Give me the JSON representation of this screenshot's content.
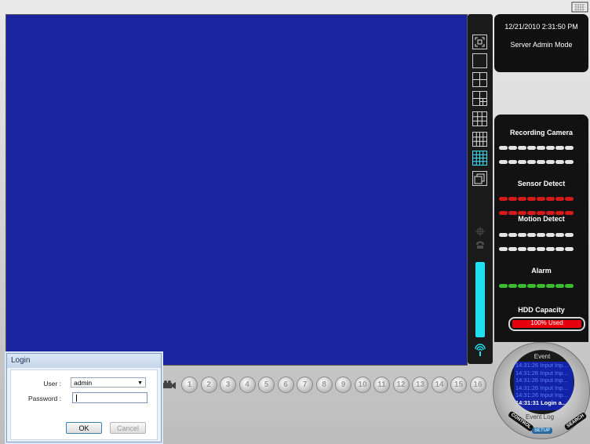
{
  "status_panel": {
    "datetime": "12/21/2010 2:31:50 PM",
    "mode": "Server Admin Mode",
    "recording_camera": "Recording Camera",
    "sensor_detect": "Sensor Detect",
    "motion_detect": "Motion Detect",
    "alarm": "Alarm",
    "hdd_capacity": "HDD Capacity",
    "hdd_used_text": "100% Used",
    "hdd_used_fraction": 1.0,
    "colors": {
      "sensor": "#d41a1a",
      "alarm": "#3bbc2e",
      "recording": "#e4e4e4",
      "hdd": "#e8000e"
    }
  },
  "toolbar": {
    "layouts": [
      "fullscreen-icon",
      "layout-1-icon",
      "layout-4-icon",
      "layout-6-icon",
      "layout-9-icon",
      "layout-10-icon",
      "layout-16-icon",
      "layout-cascade-icon"
    ],
    "active_layout": "layout-16-icon",
    "level_fraction": 1.0
  },
  "cameras": [
    "1",
    "2",
    "3",
    "4",
    "5",
    "6",
    "7",
    "8",
    "9",
    "10",
    "11",
    "12",
    "13",
    "14",
    "15",
    "16"
  ],
  "event": {
    "title": "Event",
    "items": [
      "14:31:26 Input Inp...",
      "14:31:26 Input Inp...",
      "14:31:26 Input Inp...",
      "14:31:26 Input Inp...",
      "14:31:26 Input Inp...",
      "14:31:31 Login a..."
    ],
    "log_label": "Event Log",
    "tabs": [
      "CONTROL",
      "SETUP",
      "SEARCH"
    ]
  },
  "login": {
    "title": "Login",
    "user_label": "User :",
    "user_value": "admin",
    "password_label": "Password :",
    "password_value": "",
    "ok": "OK",
    "cancel": "Cancel"
  }
}
